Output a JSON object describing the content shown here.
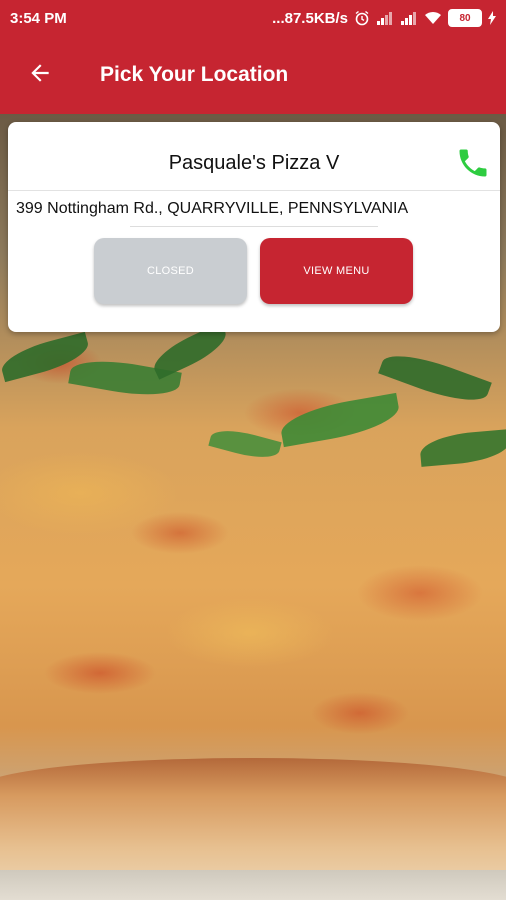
{
  "status_bar": {
    "time": "3:54 PM",
    "network_speed": "...87.5KB/s",
    "battery_level": "80",
    "icons": [
      "alarm-icon",
      "signal-icon",
      "signal-icon",
      "wifi-icon",
      "battery-icon",
      "charging-icon"
    ]
  },
  "app_bar": {
    "back_icon": "arrow-left-icon",
    "title": "Pick Your Location"
  },
  "location_card": {
    "store_name": "Pasquale's Pizza V",
    "phone_icon": "phone-icon",
    "address": "399 Nottingham Rd., QUARRYVILLE, PENNSYLVANIA",
    "status_button_label": "CLOSED",
    "menu_button_label": "VIEW MENU"
  },
  "colors": {
    "brand_red": "#c62531",
    "phone_green": "#2ecc40",
    "closed_gray": "#c9cdd1"
  }
}
